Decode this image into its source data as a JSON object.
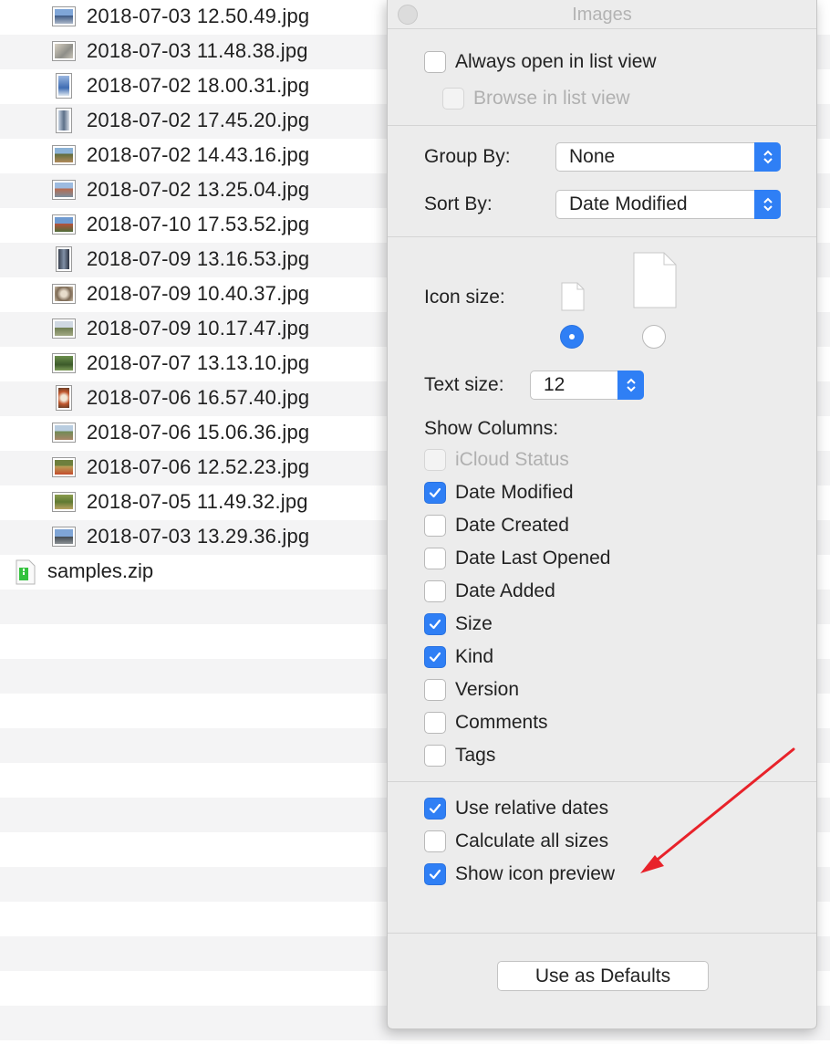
{
  "files": [
    {
      "name": "2018-07-03 12.50.49.jpg",
      "thumb": "landscape-thumbnail-icon"
    },
    {
      "name": "2018-07-03 11.48.38.jpg",
      "thumb": "landscape-thumbnail-icon"
    },
    {
      "name": "2018-07-02 18.00.31.jpg",
      "thumb": "portrait-thumbnail-icon"
    },
    {
      "name": "2018-07-02 17.45.20.jpg",
      "thumb": "portrait-thumbnail-icon"
    },
    {
      "name": "2018-07-02 14.43.16.jpg",
      "thumb": "landscape-thumbnail-icon"
    },
    {
      "name": "2018-07-02 13.25.04.jpg",
      "thumb": "landscape-thumbnail-icon"
    },
    {
      "name": "2018-07-10 17.53.52.jpg",
      "thumb": "landscape-thumbnail-icon"
    },
    {
      "name": "2018-07-09 13.16.53.jpg",
      "thumb": "portrait-thumbnail-icon"
    },
    {
      "name": "2018-07-09 10.40.37.jpg",
      "thumb": "landscape-thumbnail-icon"
    },
    {
      "name": "2018-07-09 10.17.47.jpg",
      "thumb": "landscape-thumbnail-icon"
    },
    {
      "name": "2018-07-07 13.13.10.jpg",
      "thumb": "landscape-thumbnail-icon"
    },
    {
      "name": "2018-07-06 16.57.40.jpg",
      "thumb": "portrait-thumbnail-icon"
    },
    {
      "name": "2018-07-06 15.06.36.jpg",
      "thumb": "landscape-thumbnail-icon"
    },
    {
      "name": "2018-07-06 12.52.23.jpg",
      "thumb": "landscape-thumbnail-icon"
    },
    {
      "name": "2018-07-05 11.49.32.jpg",
      "thumb": "landscape-thumbnail-icon"
    },
    {
      "name": "2018-07-03 13.29.36.jpg",
      "thumb": "landscape-thumbnail-icon"
    }
  ],
  "zip_file": {
    "name": "samples.zip",
    "icon": "zip-archive-icon"
  },
  "panel": {
    "title": "Images",
    "always_open_list": {
      "label": "Always open in list view",
      "checked": false
    },
    "browse_list": {
      "label": "Browse in list view",
      "checked": false,
      "disabled": true
    },
    "group_by": {
      "label": "Group By:",
      "value": "None"
    },
    "sort_by": {
      "label": "Sort By:",
      "value": "Date Modified"
    },
    "icon_size": {
      "label": "Icon size:",
      "selected": "small"
    },
    "text_size": {
      "label": "Text size:",
      "value": "12"
    },
    "show_columns": {
      "label": "Show Columns:",
      "items": [
        {
          "label": "iCloud Status",
          "checked": false,
          "disabled": true
        },
        {
          "label": "Date Modified",
          "checked": true
        },
        {
          "label": "Date Created",
          "checked": false
        },
        {
          "label": "Date Last Opened",
          "checked": false
        },
        {
          "label": "Date Added",
          "checked": false
        },
        {
          "label": "Size",
          "checked": true
        },
        {
          "label": "Kind",
          "checked": true
        },
        {
          "label": "Version",
          "checked": false
        },
        {
          "label": "Comments",
          "checked": false
        },
        {
          "label": "Tags",
          "checked": false
        }
      ]
    },
    "options": [
      {
        "label": "Use relative dates",
        "checked": true
      },
      {
        "label": "Calculate all sizes",
        "checked": false
      },
      {
        "label": "Show icon preview",
        "checked": true
      }
    ],
    "defaults_button": "Use as Defaults"
  },
  "colors": {
    "accent": "#2f7ff5",
    "annotation_arrow": "#e8222a"
  }
}
